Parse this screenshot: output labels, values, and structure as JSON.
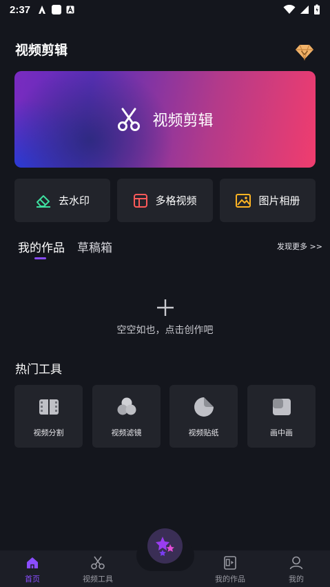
{
  "status_bar": {
    "time": "2:37"
  },
  "header": {
    "title": "视频剪辑"
  },
  "banner": {
    "label": "视频剪辑"
  },
  "quick_actions": [
    {
      "label": "去水印",
      "icon": "eraser-icon",
      "color": "#3ee0a0"
    },
    {
      "label": "多格视频",
      "icon": "grid-layout-icon",
      "color": "#ff5a5a"
    },
    {
      "label": "图片相册",
      "icon": "photo-album-icon",
      "color": "#ffb423"
    }
  ],
  "works": {
    "tabs": [
      {
        "label": "我的作品",
        "active": true
      },
      {
        "label": "草稿箱",
        "active": false
      }
    ],
    "more_label": "发现更多 >>",
    "empty_text": "空空如也，点击创作吧"
  },
  "hot_tools": {
    "title": "热门工具",
    "items": [
      {
        "label": "视频分割",
        "icon": "film-split-icon"
      },
      {
        "label": "视频滤镜",
        "icon": "filter-circles-icon"
      },
      {
        "label": "视频贴纸",
        "icon": "sticker-icon"
      },
      {
        "label": "画中画",
        "icon": "picture-in-picture-icon"
      }
    ]
  },
  "bottom_nav": [
    {
      "label": "首页",
      "icon": "home-icon",
      "active": true
    },
    {
      "label": "视频工具",
      "icon": "scissors-icon",
      "active": false
    },
    {
      "label": "我的作品",
      "icon": "works-icon",
      "active": false
    },
    {
      "label": "我的",
      "icon": "user-icon",
      "active": false
    }
  ],
  "colors": {
    "accent": "#8a4dff",
    "background": "#14161d",
    "card": "#22242b"
  }
}
